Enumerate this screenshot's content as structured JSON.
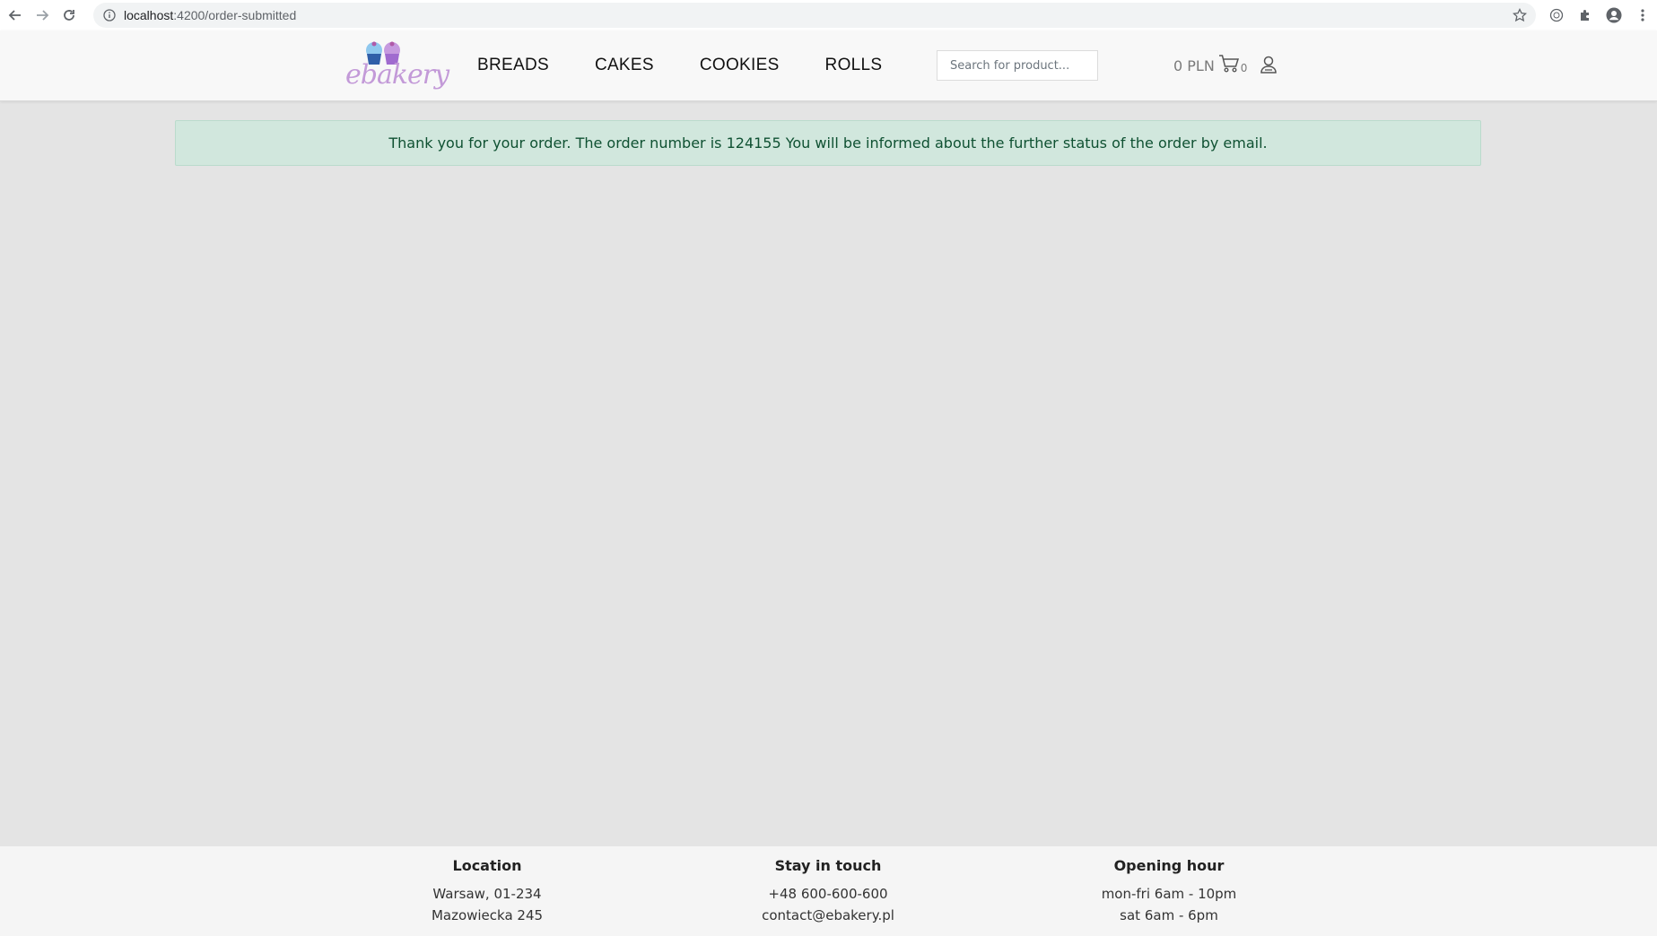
{
  "browser": {
    "url_host": "localhost",
    "url_path": ":4200/order-submitted"
  },
  "header": {
    "logo_text": "ebakery",
    "nav": [
      {
        "label": "BREADS"
      },
      {
        "label": "CAKES"
      },
      {
        "label": "COOKIES"
      },
      {
        "label": "ROLLS"
      }
    ],
    "search_placeholder": "Search for product...",
    "cart_total": "0 PLN",
    "cart_count": "0"
  },
  "alert": {
    "message": "Thank you for your order. The order number is 124155 You will be informed about the further status of the order by email."
  },
  "footer": {
    "location": {
      "title": "Location",
      "line1": "Warsaw, 01-234",
      "line2": "Mazowiecka 245"
    },
    "contact": {
      "title": "Stay in touch",
      "line1": "+48 600-600-600",
      "line2": "contact@ebakery.pl"
    },
    "hours": {
      "title": "Opening hour",
      "line1": "mon-fri 6am - 10pm",
      "line2": "sat 6am - 6pm"
    }
  },
  "colors": {
    "page_bg": "#e4e4e4",
    "header_bg": "#f8f8f8",
    "alert_bg": "#d1e7dd",
    "alert_text": "#0f5132",
    "footer_bg": "#f5f5f5"
  }
}
